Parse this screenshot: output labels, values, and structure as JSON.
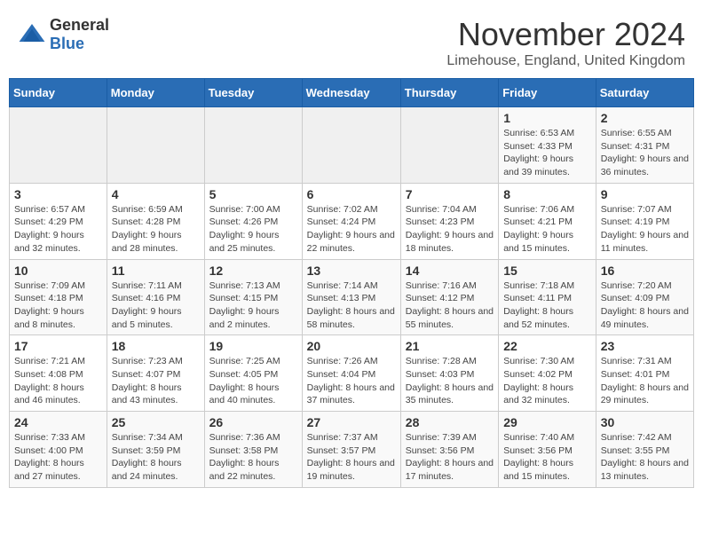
{
  "header": {
    "logo_general": "General",
    "logo_blue": "Blue",
    "month": "November 2024",
    "location": "Limehouse, England, United Kingdom"
  },
  "days_of_week": [
    "Sunday",
    "Monday",
    "Tuesday",
    "Wednesday",
    "Thursday",
    "Friday",
    "Saturday"
  ],
  "weeks": [
    [
      {
        "day": "",
        "info": ""
      },
      {
        "day": "",
        "info": ""
      },
      {
        "day": "",
        "info": ""
      },
      {
        "day": "",
        "info": ""
      },
      {
        "day": "",
        "info": ""
      },
      {
        "day": "1",
        "info": "Sunrise: 6:53 AM\nSunset: 4:33 PM\nDaylight: 9 hours and 39 minutes."
      },
      {
        "day": "2",
        "info": "Sunrise: 6:55 AM\nSunset: 4:31 PM\nDaylight: 9 hours and 36 minutes."
      }
    ],
    [
      {
        "day": "3",
        "info": "Sunrise: 6:57 AM\nSunset: 4:29 PM\nDaylight: 9 hours and 32 minutes."
      },
      {
        "day": "4",
        "info": "Sunrise: 6:59 AM\nSunset: 4:28 PM\nDaylight: 9 hours and 28 minutes."
      },
      {
        "day": "5",
        "info": "Sunrise: 7:00 AM\nSunset: 4:26 PM\nDaylight: 9 hours and 25 minutes."
      },
      {
        "day": "6",
        "info": "Sunrise: 7:02 AM\nSunset: 4:24 PM\nDaylight: 9 hours and 22 minutes."
      },
      {
        "day": "7",
        "info": "Sunrise: 7:04 AM\nSunset: 4:23 PM\nDaylight: 9 hours and 18 minutes."
      },
      {
        "day": "8",
        "info": "Sunrise: 7:06 AM\nSunset: 4:21 PM\nDaylight: 9 hours and 15 minutes."
      },
      {
        "day": "9",
        "info": "Sunrise: 7:07 AM\nSunset: 4:19 PM\nDaylight: 9 hours and 11 minutes."
      }
    ],
    [
      {
        "day": "10",
        "info": "Sunrise: 7:09 AM\nSunset: 4:18 PM\nDaylight: 9 hours and 8 minutes."
      },
      {
        "day": "11",
        "info": "Sunrise: 7:11 AM\nSunset: 4:16 PM\nDaylight: 9 hours and 5 minutes."
      },
      {
        "day": "12",
        "info": "Sunrise: 7:13 AM\nSunset: 4:15 PM\nDaylight: 9 hours and 2 minutes."
      },
      {
        "day": "13",
        "info": "Sunrise: 7:14 AM\nSunset: 4:13 PM\nDaylight: 8 hours and 58 minutes."
      },
      {
        "day": "14",
        "info": "Sunrise: 7:16 AM\nSunset: 4:12 PM\nDaylight: 8 hours and 55 minutes."
      },
      {
        "day": "15",
        "info": "Sunrise: 7:18 AM\nSunset: 4:11 PM\nDaylight: 8 hours and 52 minutes."
      },
      {
        "day": "16",
        "info": "Sunrise: 7:20 AM\nSunset: 4:09 PM\nDaylight: 8 hours and 49 minutes."
      }
    ],
    [
      {
        "day": "17",
        "info": "Sunrise: 7:21 AM\nSunset: 4:08 PM\nDaylight: 8 hours and 46 minutes."
      },
      {
        "day": "18",
        "info": "Sunrise: 7:23 AM\nSunset: 4:07 PM\nDaylight: 8 hours and 43 minutes."
      },
      {
        "day": "19",
        "info": "Sunrise: 7:25 AM\nSunset: 4:05 PM\nDaylight: 8 hours and 40 minutes."
      },
      {
        "day": "20",
        "info": "Sunrise: 7:26 AM\nSunset: 4:04 PM\nDaylight: 8 hours and 37 minutes."
      },
      {
        "day": "21",
        "info": "Sunrise: 7:28 AM\nSunset: 4:03 PM\nDaylight: 8 hours and 35 minutes."
      },
      {
        "day": "22",
        "info": "Sunrise: 7:30 AM\nSunset: 4:02 PM\nDaylight: 8 hours and 32 minutes."
      },
      {
        "day": "23",
        "info": "Sunrise: 7:31 AM\nSunset: 4:01 PM\nDaylight: 8 hours and 29 minutes."
      }
    ],
    [
      {
        "day": "24",
        "info": "Sunrise: 7:33 AM\nSunset: 4:00 PM\nDaylight: 8 hours and 27 minutes."
      },
      {
        "day": "25",
        "info": "Sunrise: 7:34 AM\nSunset: 3:59 PM\nDaylight: 8 hours and 24 minutes."
      },
      {
        "day": "26",
        "info": "Sunrise: 7:36 AM\nSunset: 3:58 PM\nDaylight: 8 hours and 22 minutes."
      },
      {
        "day": "27",
        "info": "Sunrise: 7:37 AM\nSunset: 3:57 PM\nDaylight: 8 hours and 19 minutes."
      },
      {
        "day": "28",
        "info": "Sunrise: 7:39 AM\nSunset: 3:56 PM\nDaylight: 8 hours and 17 minutes."
      },
      {
        "day": "29",
        "info": "Sunrise: 7:40 AM\nSunset: 3:56 PM\nDaylight: 8 hours and 15 minutes."
      },
      {
        "day": "30",
        "info": "Sunrise: 7:42 AM\nSunset: 3:55 PM\nDaylight: 8 hours and 13 minutes."
      }
    ]
  ]
}
